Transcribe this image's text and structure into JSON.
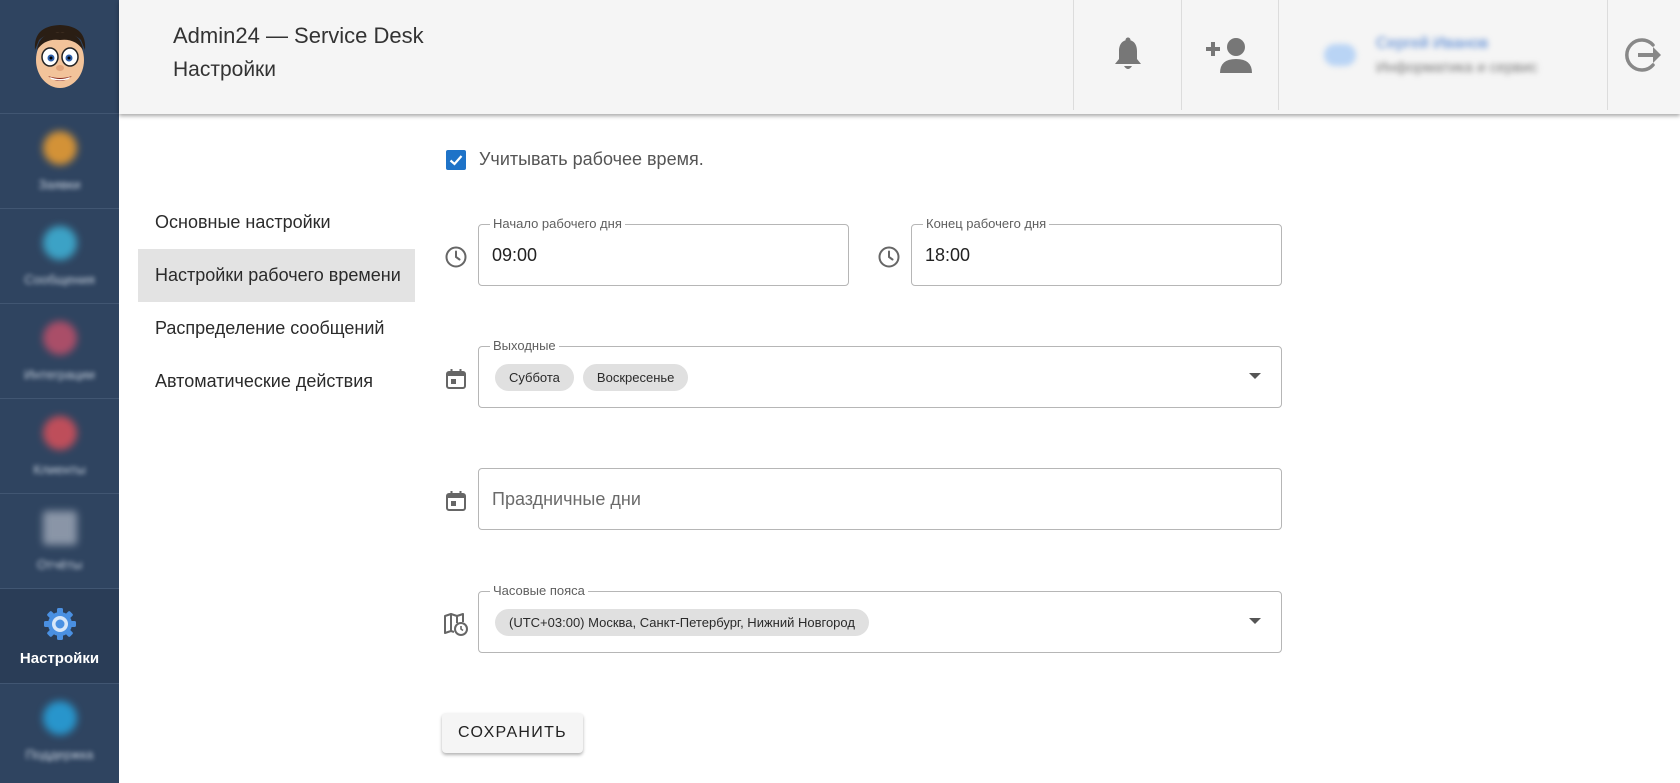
{
  "header": {
    "app_title": "Admin24 — Service Desk",
    "page_title": "Настройки",
    "user": {
      "name": "Сергей Иванов",
      "subtitle": "Информатика и сервис"
    }
  },
  "sidebar": {
    "items": [
      {
        "label": "Заявки",
        "icon": "tickets-icon",
        "color": "#f0a030"
      },
      {
        "label": "Сообщения",
        "icon": "messages-icon",
        "color": "#3fb3d8"
      },
      {
        "label": "Интеграции",
        "icon": "integrations-icon",
        "color": "#c0506a"
      },
      {
        "label": "Клиенты",
        "icon": "clients-icon",
        "color": "#d8505a"
      },
      {
        "label": "Отчёты",
        "icon": "reports-icon",
        "color": "#9aa4b4"
      },
      {
        "label": "Настройки",
        "icon": "gear-icon",
        "color": "#4a90e2",
        "active": true
      },
      {
        "label": "Поддержка",
        "icon": "support-icon",
        "color": "#27a4df"
      }
    ]
  },
  "settings_menu": {
    "items": [
      {
        "label": "Основные настройки"
      },
      {
        "label": "Настройки рабочего времени",
        "selected": true
      },
      {
        "label": "Распределение сообщений"
      },
      {
        "label": "Автоматические действия"
      }
    ]
  },
  "form": {
    "consider_working_time": {
      "label": "Учитывать рабочее время.",
      "checked": true
    },
    "workday_start": {
      "label": "Начало рабочего дня",
      "value": "09:00"
    },
    "workday_end": {
      "label": "Конец рабочего дня",
      "value": "18:00"
    },
    "days_off": {
      "label": "Выходные",
      "chips": [
        "Суббота",
        "Воскресенье"
      ]
    },
    "holidays": {
      "placeholder": "Праздничные дни"
    },
    "timezones": {
      "label": "Часовые пояса",
      "chips": [
        "(UTC+03:00) Москва, Санкт-Петербург, Нижний Новгород"
      ]
    },
    "save_label": "СОХРАНИТЬ"
  },
  "colors": {
    "sidebar_bg": "#2f4460",
    "header_bg": "#f5f5f5",
    "accent": "#1e73c8",
    "chip_bg": "#e0e0e0",
    "selected_menu_bg": "#e3e3e3"
  }
}
